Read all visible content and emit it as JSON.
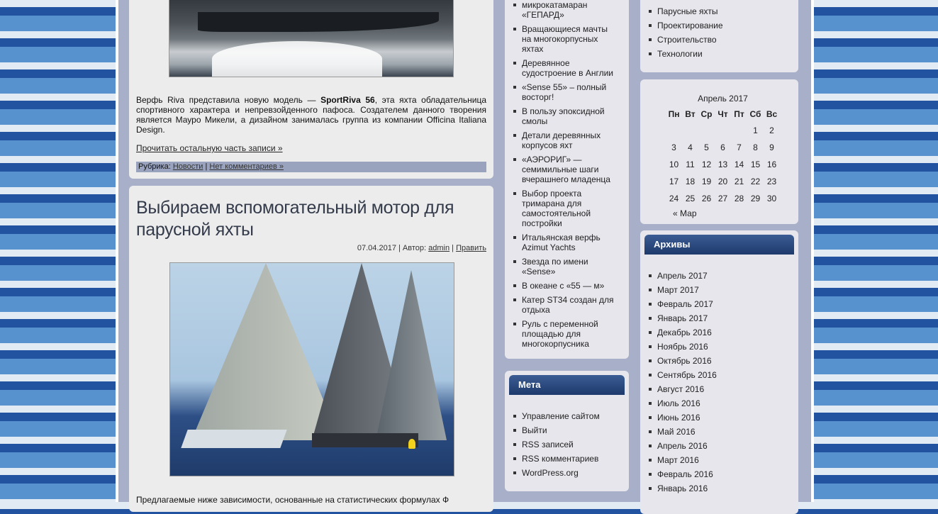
{
  "post1": {
    "text_prefix": "Верфь Riva представила новую модель — ",
    "text_bold": "SportRiva 56",
    "text_suffix": ", эта яхта обладательница спортивного характера и непревзойденного пафоса. Создателем данного творения является Мауро Микели, а дизайном занималась группа из компании Officina Italiana Design.",
    "read_more": "Прочитать остальную часть записи »",
    "category_label": "Рубрика:",
    "category_link": "Новости",
    "separator": "|",
    "comments_link": "Нет комментариев »"
  },
  "post2": {
    "title": "Выбираем вспомогательный мотор для парусной яхты",
    "date": "07.04.2017",
    "author_label": "| Автор:",
    "author": "admin",
    "separator": "|",
    "edit": "Править",
    "text": "Предлагаемые ниже зависимости, основанные на статистических формулах Ф"
  },
  "recent_posts": [
    "микрокатамаран «ГЕПАРД»",
    "Вращающиеся мачты на многокорпусных яхтах",
    "Деревянное судостроение в Англии",
    "«Sense 55» – полный восторг!",
    "В пользу эпоксидной смолы",
    "Детали деревянных корпусов яхт",
    "«АЭРОРИГ» — семимильные шаги вчерашнего младенца",
    "Выбор проекта тримарана для самостоятельной постройки",
    "Итальянская верфь Azimut Yachts",
    "Звезда по имени «Sense»",
    "В океане с «55 — м»",
    "Катер ST34 создан для отдыха",
    "Руль с переменной площадью для многокорпусника"
  ],
  "meta": {
    "title": "Мета",
    "items": [
      "Управление сайтом",
      "Выйти",
      "RSS записей",
      "RSS комментариев",
      "WordPress.org"
    ]
  },
  "categories": [
    "Парусные яхты",
    "Проектирование",
    "Строительство",
    "Технологии"
  ],
  "calendar": {
    "caption": "Апрель 2017",
    "days": [
      "Пн",
      "Вт",
      "Ср",
      "Чт",
      "Пт",
      "Сб",
      "Вс"
    ],
    "weeks": [
      [
        "",
        "",
        "",
        "",
        "",
        "1",
        "2"
      ],
      [
        "3",
        "4",
        "5",
        "6",
        "7",
        "8",
        "9"
      ],
      [
        "10",
        "11",
        "12",
        "13",
        "14",
        "15",
        "16"
      ],
      [
        "17",
        "18",
        "19",
        "20",
        "21",
        "22",
        "23"
      ],
      [
        "24",
        "25",
        "26",
        "27",
        "28",
        "29",
        "30"
      ]
    ],
    "prev": "« Мар"
  },
  "archives": {
    "title": "Архивы",
    "items": [
      "Апрель 2017",
      "Март 2017",
      "Февраль 2017",
      "Январь 2017",
      "Декабрь 2016",
      "Ноябрь 2016",
      "Октябрь 2016",
      "Сентябрь 2016",
      "Август 2016",
      "Июль 2016",
      "Июнь 2016",
      "Май 2016",
      "Апрель 2016",
      "Март 2016",
      "Февраль 2016",
      "Январь 2016"
    ]
  }
}
